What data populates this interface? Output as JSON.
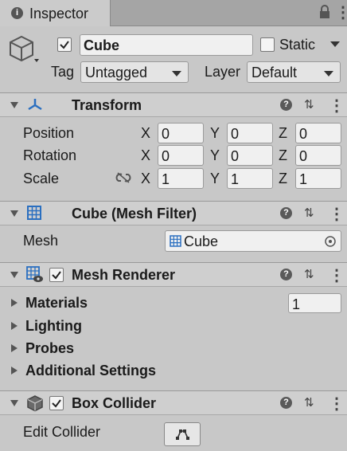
{
  "window": {
    "tab_title": "Inspector",
    "info_glyph": "i"
  },
  "header": {
    "object_name": "Cube",
    "active": true,
    "static_label": "Static",
    "static_checked": false,
    "tag_label": "Tag",
    "tag_value": "Untagged",
    "layer_label": "Layer",
    "layer_value": "Default"
  },
  "transform": {
    "title": "Transform",
    "rows": [
      {
        "label": "Position",
        "x": "0",
        "y": "0",
        "z": "0"
      },
      {
        "label": "Rotation",
        "x": "0",
        "y": "0",
        "z": "0"
      },
      {
        "label": "Scale",
        "x": "1",
        "y": "1",
        "z": "1"
      }
    ],
    "axis_x": "X",
    "axis_y": "Y",
    "axis_z": "Z"
  },
  "mesh_filter": {
    "title": "Cube (Mesh Filter)",
    "mesh_label": "Mesh",
    "mesh_value": "Cube"
  },
  "mesh_renderer": {
    "title": "Mesh Renderer",
    "enabled": true,
    "materials_label": "Materials",
    "materials_count": "1",
    "lighting_label": "Lighting",
    "probes_label": "Probes",
    "additional_label": "Additional Settings"
  },
  "box_collider": {
    "title": "Box Collider",
    "enabled": true,
    "edit_label": "Edit Collider"
  },
  "icons": {
    "help_glyph": "?",
    "more_glyph": "⋮",
    "settings_glyph": "⇅"
  }
}
